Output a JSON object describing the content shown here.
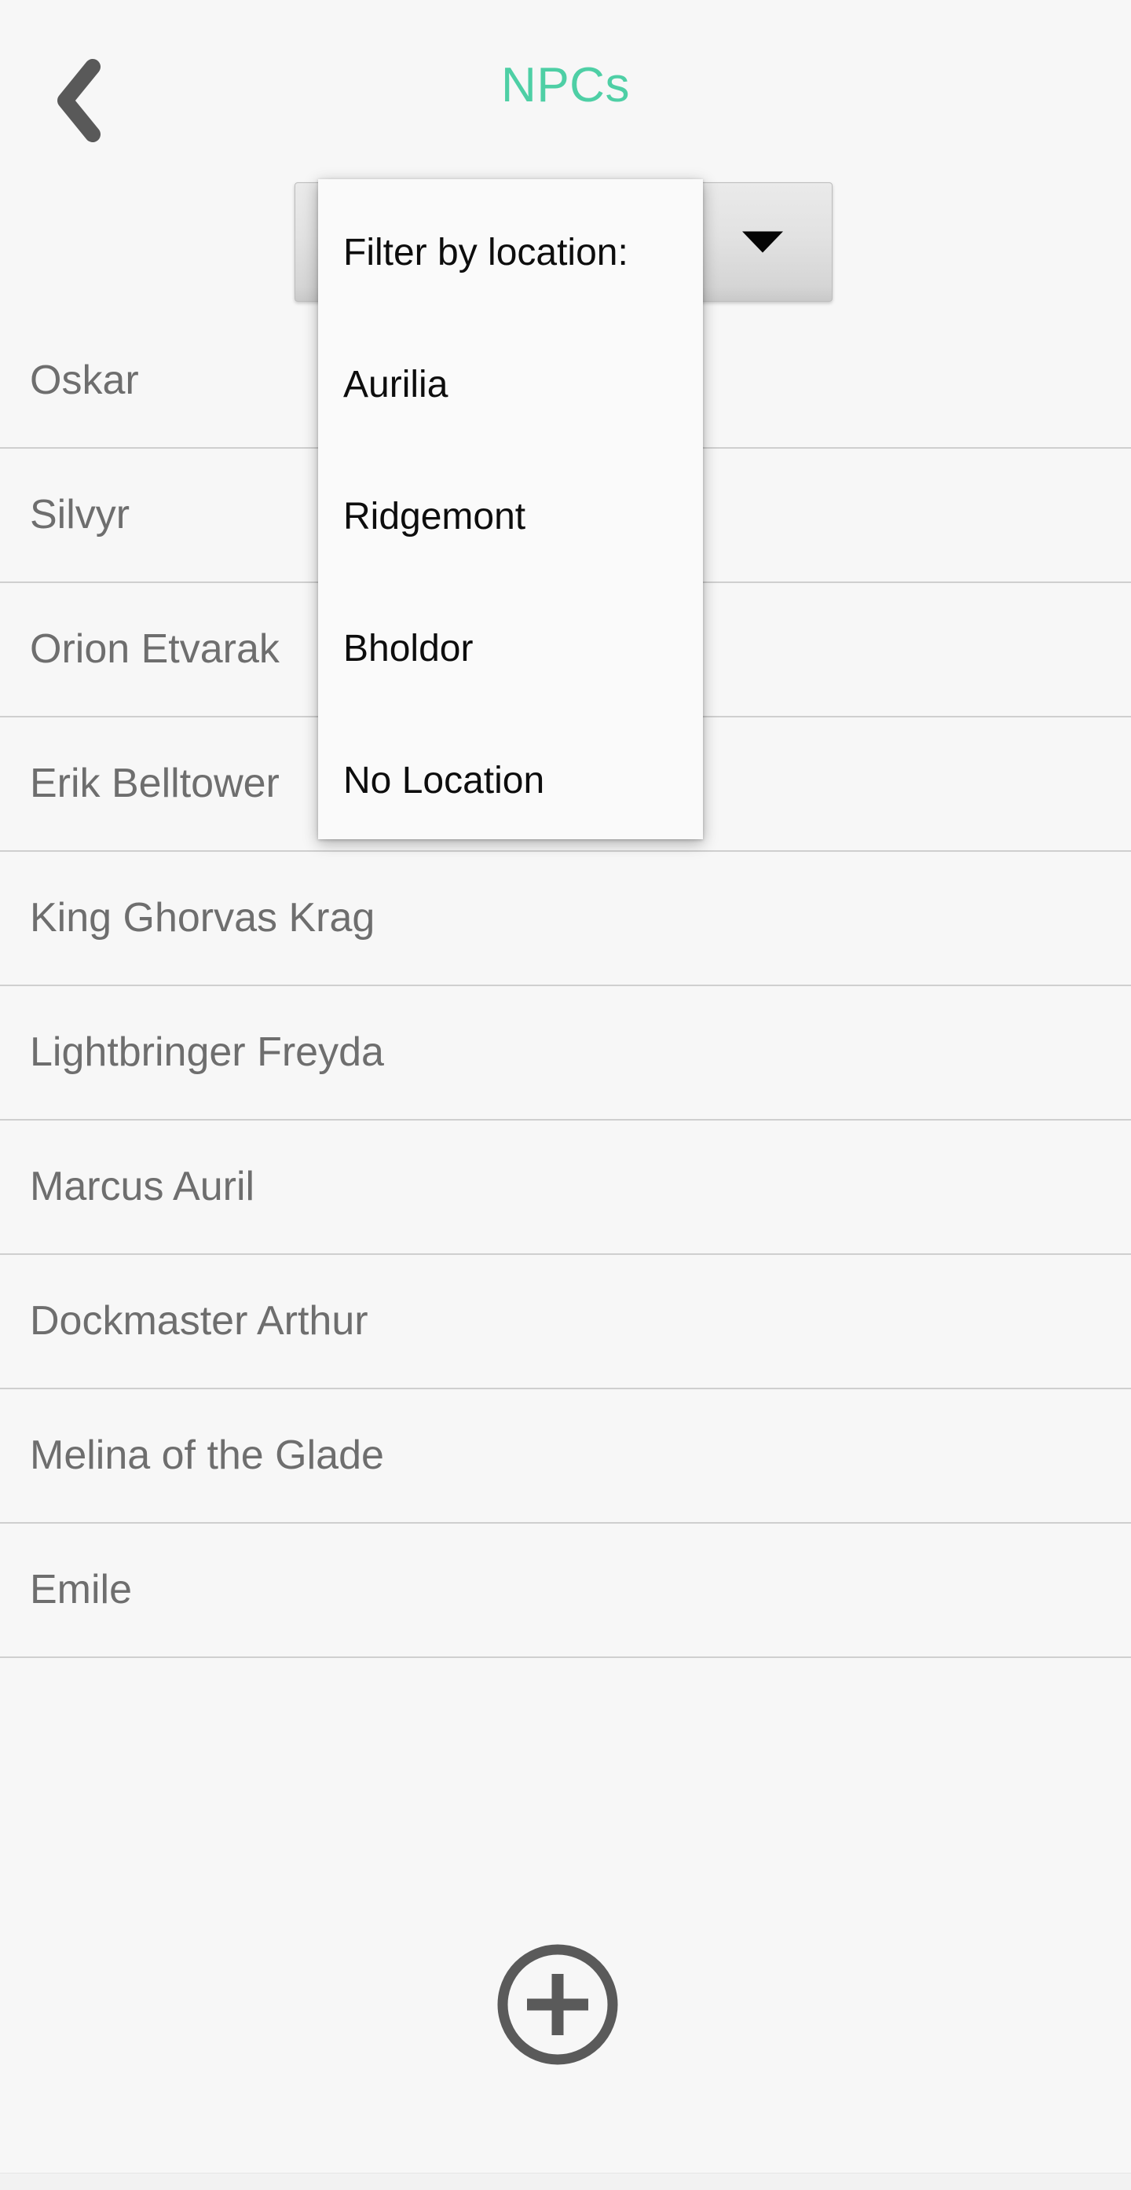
{
  "header": {
    "title": "NPCs",
    "back_icon": "chevron-left-icon",
    "title_color": "#4ecfa5",
    "back_icon_color": "#595959"
  },
  "filter_control": {
    "selected_value": "",
    "arrow_icon": "triangle-down-icon",
    "arrow_color": "#050505"
  },
  "dropdown": {
    "open": true,
    "header_label": "Filter by location:",
    "options": [
      {
        "label": "Aurilia"
      },
      {
        "label": "Ridgemont"
      },
      {
        "label": "Bholdor"
      },
      {
        "label": "No Location"
      }
    ]
  },
  "npc_list": {
    "rows": [
      {
        "name": "Oskar"
      },
      {
        "name": "Silvyr"
      },
      {
        "name": "Orion Etvarak"
      },
      {
        "name": "Erik Belltower"
      },
      {
        "name": "King Ghorvas Krag"
      },
      {
        "name": "Lightbringer Freyda"
      },
      {
        "name": "Marcus Auril"
      },
      {
        "name": "Dockmaster Arthur"
      },
      {
        "name": "Melina of the Glade"
      },
      {
        "name": "Emile"
      }
    ]
  },
  "add_button": {
    "icon": "plus-circle-icon",
    "color": "#5a5a5a"
  },
  "colors": {
    "background": "#f7f7f7",
    "list_text": "#6e6e6e",
    "divider": "#cfcfcf",
    "popup_background": "#fafafa",
    "popup_text": "#0d0d0d"
  }
}
